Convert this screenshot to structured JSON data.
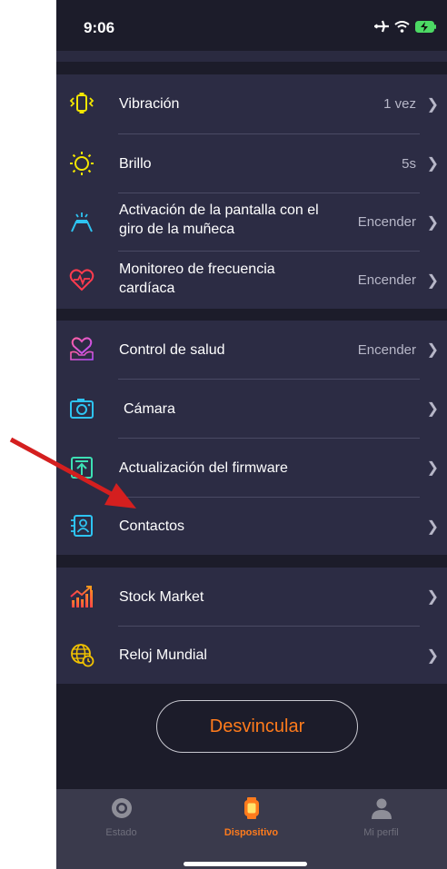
{
  "status_bar": {
    "time": "9:06"
  },
  "settings": {
    "group1": [
      {
        "label": "Vibración",
        "value": "1 vez",
        "icon": "vibration-icon"
      },
      {
        "label": "Brillo",
        "value": "5s",
        "icon": "brightness-icon"
      },
      {
        "label": "Activación de la pantalla con el giro de la muñeca",
        "value": "Encender",
        "icon": "wrist-raise-icon"
      },
      {
        "label": "Monitoreo de frecuencia cardíaca",
        "value": "Encender",
        "icon": "heart-rate-icon"
      }
    ],
    "group2": [
      {
        "label": "Control de salud",
        "value": "Encender",
        "icon": "health-heart-icon"
      },
      {
        "label": "Cámara",
        "value": "",
        "icon": "camera-icon"
      },
      {
        "label": "Actualización del firmware",
        "value": "",
        "icon": "firmware-update-icon"
      },
      {
        "label": "Contactos",
        "value": "",
        "icon": "contacts-icon"
      }
    ],
    "group3": [
      {
        "label": "Stock Market",
        "value": "",
        "icon": "stock-chart-icon"
      },
      {
        "label": "Reloj Mundial",
        "value": "",
        "icon": "world-clock-icon"
      }
    ]
  },
  "unlink_button": "Desvincular",
  "tabs": [
    {
      "label": "Estado",
      "icon": "status-icon",
      "active": false
    },
    {
      "label": "Dispositivo",
      "icon": "watch-icon",
      "active": true
    },
    {
      "label": "Mi perfil",
      "icon": "profile-icon",
      "active": false
    }
  ],
  "colors": {
    "accent": "#ff7b1c",
    "background": "#1c1c2a",
    "group_bg": "#2c2c44",
    "arrow": "#d41f1f"
  }
}
